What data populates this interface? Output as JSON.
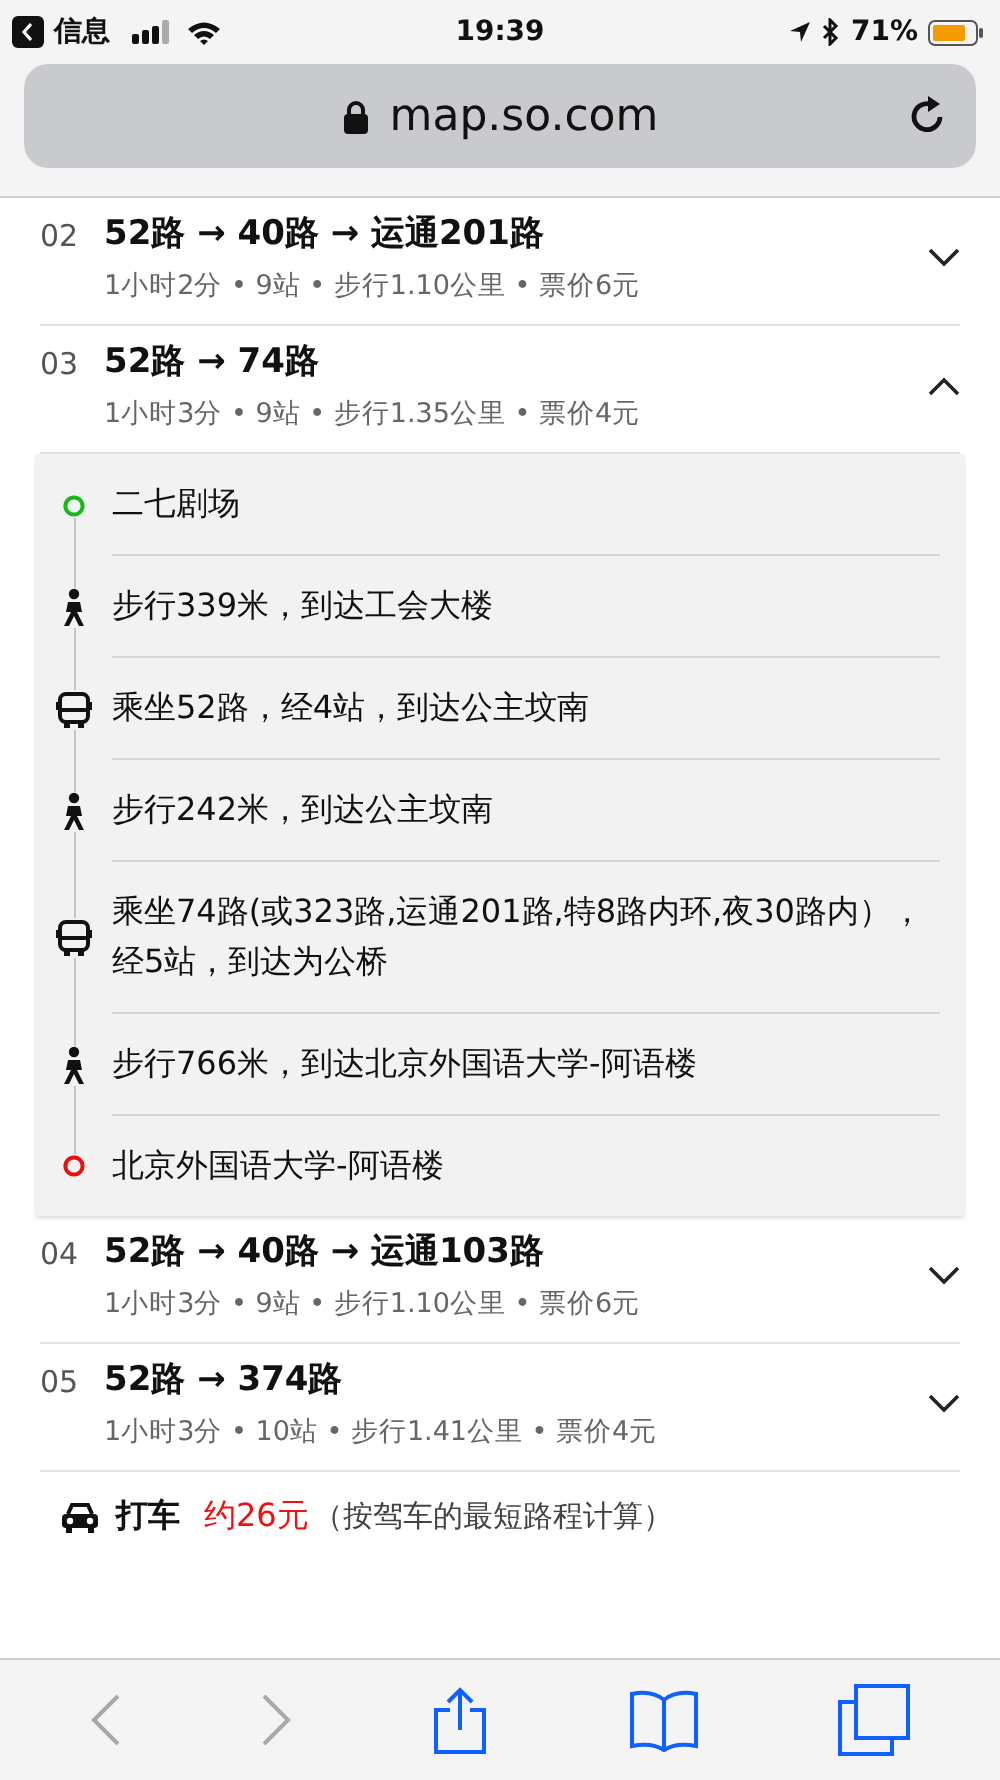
{
  "status_bar": {
    "back_app": "信息",
    "time": "19:39",
    "battery": "71%"
  },
  "address_bar": {
    "url": "map.so.com"
  },
  "routes": [
    {
      "number": "02",
      "title": "52路 → 40路 → 运通201路",
      "meta": "1小时2分 • 9站 • 步行1.10公里 • 票价6元",
      "expanded": false
    },
    {
      "number": "03",
      "title": "52路 → 74路",
      "meta": "1小时3分 • 9站 • 步行1.35公里 • 票价4元",
      "expanded": true,
      "steps": [
        {
          "kind": "start",
          "text": "二七剧场"
        },
        {
          "kind": "walk",
          "text": "步行339米，到达工会大楼"
        },
        {
          "kind": "bus",
          "text": "乘坐52路，经4站，到达公主坟南"
        },
        {
          "kind": "walk",
          "text": "步行242米，到达公主坟南"
        },
        {
          "kind": "bus",
          "text": "乘坐74路(或323路,运通201路,特8路内环,夜30路内），经5站，到达为公桥"
        },
        {
          "kind": "walk",
          "text": "步行766米，到达北京外国语大学-阿语楼"
        },
        {
          "kind": "end",
          "text": "北京外国语大学-阿语楼"
        }
      ]
    },
    {
      "number": "04",
      "title": "52路 → 40路 → 运通103路",
      "meta": "1小时3分 • 9站 • 步行1.10公里 • 票价6元",
      "expanded": false
    },
    {
      "number": "05",
      "title": "52路 → 374路",
      "meta": "1小时3分 • 10站 • 步行1.41公里 • 票价4元",
      "expanded": false
    }
  ],
  "taxi": {
    "label": "打车",
    "price": "约26元",
    "note": "（按驾车的最短路程计算）"
  },
  "toolbar": [
    {
      "kind": "back",
      "disabled": true
    },
    {
      "kind": "forward",
      "disabled": true
    },
    {
      "kind": "share",
      "disabled": false
    },
    {
      "kind": "bookmarks",
      "disabled": false
    },
    {
      "kind": "tabs",
      "disabled": false
    }
  ]
}
